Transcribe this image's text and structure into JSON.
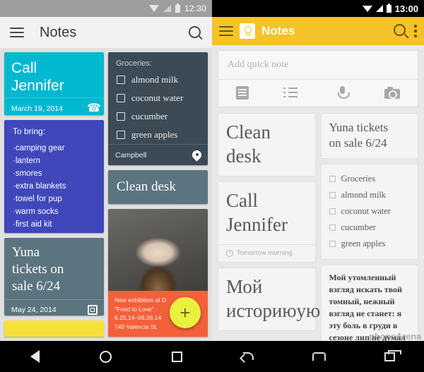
{
  "left_phone": {
    "status": {
      "time": "12:30",
      "icons": [
        "wifi-icon",
        "signal-icon",
        "battery-icon"
      ]
    },
    "toolbar": {
      "menu_icon": "hamburger-icon",
      "title": "Notes",
      "search_icon": "search-icon"
    },
    "column_left": {
      "call_card": {
        "title": "Call\nJennifer",
        "title_line1": "Call",
        "title_line2": "Jennifer",
        "date": "March 19, 2014",
        "icon": "phone-icon",
        "color": "#00b8d0"
      },
      "bring_card": {
        "header": "To bring:",
        "items": [
          "camping gear",
          "lantern",
          "smores",
          "extra blankets",
          "towel for pup",
          "warm socks",
          "first aid kit"
        ],
        "color": "#3f47bb"
      },
      "yuna_card": {
        "title_line1": "Yuna",
        "title_line2": "tickets on",
        "title_line3": "sale 6/24",
        "date": "May 24, 2014",
        "icon": "calendar-icon",
        "color": "#5b7480"
      },
      "yellow_card": {
        "color": "#f7e03c"
      }
    },
    "column_right": {
      "groceries_card": {
        "header": "Groceries:",
        "items": [
          "almond milk",
          "coconut water",
          "cucumber",
          "green apples"
        ],
        "location": "Campbell",
        "icon": "location-pin-icon",
        "color": "#3c4a55"
      },
      "clean_desk_card": {
        "title": "Clean desk",
        "color": "#5b7480"
      },
      "photo_card": {
        "image_alt": "dessert-photo",
        "overlay": {
          "line1": "New exhibition at D",
          "line2": "\"Food to Love\"",
          "line3": "6.25.14–06.26.14",
          "line4": "740 Valencia St.",
          "color": "#f4603a"
        },
        "fab": {
          "label": "+",
          "color": "#e9f13e"
        }
      }
    },
    "nav": {
      "back_icon": "back-triangle-icon",
      "home_icon": "home-circle-icon",
      "recents_icon": "recents-square-icon"
    }
  },
  "right_phone": {
    "status": {
      "time": "13:00",
      "icons": [
        "wifi-icon",
        "signal-icon",
        "battery-icon"
      ]
    },
    "toolbar": {
      "menu_icon": "hamburger-icon",
      "logo_icon": "keep-bulb-icon",
      "title": "Notes",
      "search_icon": "search-icon",
      "overflow_icon": "overflow-menu-icon",
      "color": "#f5c22a"
    },
    "quick_note": {
      "placeholder": "Add quick note",
      "value": "",
      "actions": [
        "note-icon",
        "list-icon",
        "microphone-icon",
        "camera-icon"
      ]
    },
    "column_left": {
      "clean_desk_card": {
        "line1": "Clean",
        "line2": "desk"
      },
      "call_card": {
        "line1": "Call",
        "line2": "Jennifer",
        "reminder": "Tomorrow morning",
        "reminder_icon": "clock-icon"
      },
      "russian_card": {
        "line1": "Мой",
        "line2": "историюую"
      }
    },
    "column_right": {
      "yuna_card": {
        "line1": "Yuna tickets",
        "line2": "on sale 6/24"
      },
      "checklist_card": {
        "items": [
          "Groceries",
          "almond milk",
          "coconut water",
          "cucumber",
          "green apples"
        ]
      },
      "poem_card": {
        "text": "Мой утомленный взгляд искать твой томный, нежный взгляд не станет: я эту боль в груди в сезоне лип не думал"
      }
    },
    "nav": {
      "back_icon": "back-arrow-icon",
      "home_icon": "home-icon",
      "recents_icon": "recents-icon"
    },
    "watermark": "phoneArena"
  }
}
